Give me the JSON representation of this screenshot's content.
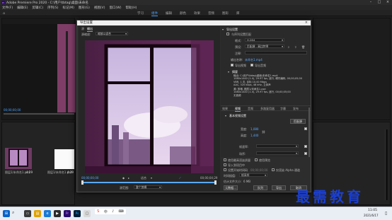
{
  "app": {
    "title": "Adobe Premiere Pro 2020 - C:\\用户\\tbtag\\桌面\\未命名",
    "menu": [
      "文件(F)",
      "编辑(E)",
      "剪辑(C)",
      "序列(S)",
      "标记(M)",
      "图形(G)",
      "视图(V)",
      "窗口(W)",
      "帮助(H)"
    ],
    "workspaces": [
      "学习",
      "组件",
      "编辑",
      "颜色",
      "效果",
      "音频",
      "图形",
      "库"
    ],
    "active_workspace": "组件"
  },
  "dialog": {
    "title": "导出设置",
    "left_tabs": [
      "源",
      "输出"
    ],
    "active_left_tab": "输出",
    "source_scaling_label": "源缩放:",
    "source_scaling_value": "缩放以适合",
    "timecode_start": "00;00;00;00",
    "timecode_end": "00;00;04;29",
    "fit_label": "适合",
    "source_range_label": "源范围:",
    "source_range_value": "整个剪辑",
    "export_settings_header": "导出设置",
    "match_sequence_label": "与序列设置匹配",
    "format_label": "格式:",
    "format_value": "H.264",
    "preset_label": "预设:",
    "preset_value": "匹配源 - 高比特率",
    "comments_label": "注释:",
    "output_name_label": "输出名称:",
    "output_name_value": "未命名1.mp4",
    "export_video_label": "导出视频",
    "export_audio_label": "导出音频",
    "summary_label": "摘要",
    "summary_output_lines": [
      "输出: C:\\用户\\tbtag\\桌面\\未命名1.mp4",
      "1080x1440 (1.0), 29.97 fps, 逐行, 硬件编码, 00;00;05;00",
      "VBR, 1 次, 目标 10.00 Mbps",
      "AAC, 320 kbps, 48 kHz, 立体声"
    ],
    "summary_source_lines": [
      "源: 剪辑, 图层1/未命名1.psd",
      "1080x1440 (1.0), 29.97 fps, 逐行, 00;00;05;00",
      "无音频"
    ],
    "section_tabs": [
      "效果",
      "视频",
      "音频",
      "多路复用器",
      "字幕",
      "发布"
    ],
    "active_section_tab": "视频",
    "basic_video_header": "基本视频设置",
    "match_source_button": "匹配源",
    "width_label": "宽度:",
    "width_value": "1,080",
    "height_label": "高度:",
    "height_value": "1,440",
    "framerate_label": "帧速率:",
    "field_order_label": "场序:",
    "bottom_checks": [
      "使用最高渲染质量",
      "使用预览",
      "导入到项目中",
      "设置开始时间码",
      "仅渲染 Alpha 通道"
    ],
    "start_timecode": "00;00;00;00",
    "time_interp_label": "时间插值:",
    "time_interp_value": "帧采样",
    "estimated_size_label": "估计文件大小:",
    "estimated_size_value": "6 MB",
    "buttons": {
      "metadata": "元数据...",
      "queue": "队列",
      "export": "导出",
      "cancel": "取消"
    }
  },
  "background": {
    "project_items": [
      {
        "name": "图层1/未命名1.psd",
        "dur": "4:29"
      },
      {
        "name": "图层1/未命名1.psd",
        "dur": "4:29"
      }
    ],
    "timecode": "00;00;00;00"
  },
  "taskbar": {
    "search_placeholder": "在这里输入你要搜索的内容",
    "time": "11:05",
    "date": "2021/6/17"
  },
  "watermark": "最需教育",
  "colors": {
    "accent": "#5aa9ff",
    "watermark": "#1b3fd1",
    "dialog_bg": "#2d2d2d"
  }
}
